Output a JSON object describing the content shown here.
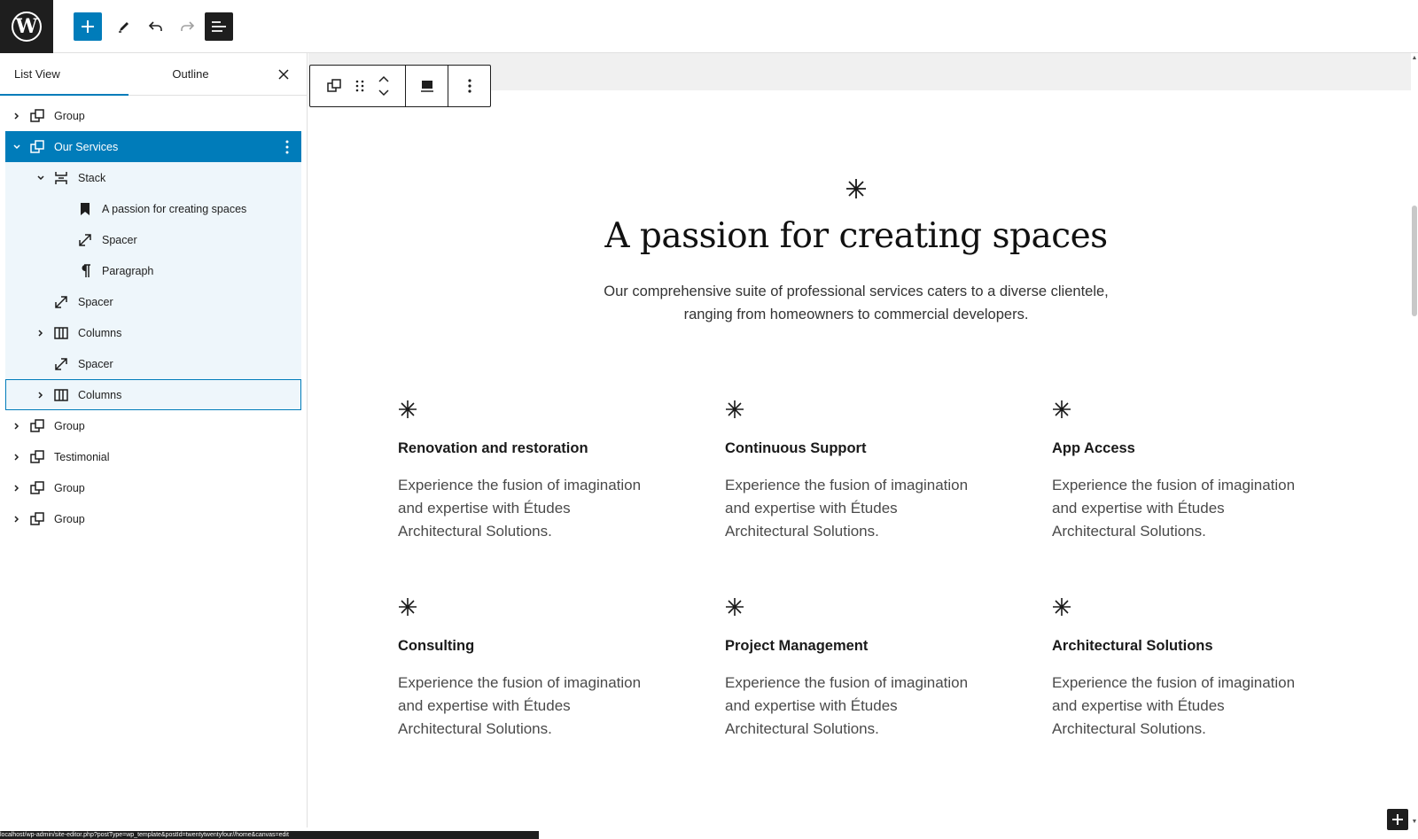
{
  "topbar": {
    "logo": "W",
    "icons": [
      "wordpress-icon",
      "plus-icon",
      "pencil-icon",
      "undo-icon",
      "redo-icon",
      "list-view-icon"
    ]
  },
  "sidebar": {
    "tabs": [
      {
        "label": "List View",
        "active": true
      },
      {
        "label": "Outline",
        "active": false
      }
    ],
    "rows": [
      {
        "label": "Group",
        "icon": "group-icon",
        "level": 0,
        "chevron": "right",
        "state": "normal"
      },
      {
        "label": "Our Services",
        "icon": "group-icon",
        "level": 0,
        "chevron": "down",
        "state": "selected"
      },
      {
        "label": "Stack",
        "icon": "stack-icon",
        "level": 1,
        "chevron": "down",
        "state": "tinted"
      },
      {
        "label": "A passion for creating spaces",
        "icon": "bookmark-icon",
        "level": 2,
        "chevron": "",
        "state": "tinted"
      },
      {
        "label": "Spacer",
        "icon": "spacer-icon",
        "level": 2,
        "chevron": "",
        "state": "tinted"
      },
      {
        "label": "Paragraph",
        "icon": "paragraph-icon",
        "level": 2,
        "chevron": "",
        "state": "tinted"
      },
      {
        "label": "Spacer",
        "icon": "spacer-icon",
        "level": 1,
        "chevron": "",
        "state": "tinted"
      },
      {
        "label": "Columns",
        "icon": "columns-icon",
        "level": 1,
        "chevron": "right",
        "state": "tinted"
      },
      {
        "label": "Spacer",
        "icon": "spacer-icon",
        "level": 1,
        "chevron": "",
        "state": "tinted"
      },
      {
        "label": "Columns",
        "icon": "columns-icon",
        "level": 1,
        "chevron": "right",
        "state": "focused"
      },
      {
        "label": "Group",
        "icon": "group-icon",
        "level": 0,
        "chevron": "right",
        "state": "normal"
      },
      {
        "label": "Testimonial",
        "icon": "group-icon",
        "level": 0,
        "chevron": "right",
        "state": "normal"
      },
      {
        "label": "Group",
        "icon": "group-icon",
        "level": 0,
        "chevron": "right",
        "state": "normal"
      },
      {
        "label": "Group",
        "icon": "group-icon",
        "level": 0,
        "chevron": "right",
        "state": "normal"
      }
    ]
  },
  "block_toolbar": {
    "icons": [
      "group-icon",
      "drag-handle-icon",
      "move-up-icon",
      "move-down-icon",
      "align-icon",
      "more-options-icon"
    ]
  },
  "hero": {
    "title": "A passion for creating spaces",
    "subtitle_line1": "Our comprehensive suite of professional services caters to a diverse clientele,",
    "subtitle_line2": "ranging from homeowners to commercial developers."
  },
  "services": [
    {
      "title": "Renovation and restoration",
      "l1": "Experience the fusion of imagination",
      "l2": "and expertise with Études",
      "l3": "Architectural Solutions."
    },
    {
      "title": "Continuous Support",
      "l1": "Experience the fusion of imagination",
      "l2": "and expertise with Études",
      "l3": "Architectural Solutions."
    },
    {
      "title": "App Access",
      "l1": "Experience the fusion of imagination",
      "l2": "and expertise with Études",
      "l3": "Architectural Solutions."
    },
    {
      "title": "Consulting",
      "l1": "Experience the fusion of imagination",
      "l2": "and expertise with Études",
      "l3": "Architectural Solutions."
    },
    {
      "title": "Project Management",
      "l1": "Experience the fusion of imagination",
      "l2": "and expertise with Études",
      "l3": "Architectural Solutions."
    },
    {
      "title": "Architectural Solutions",
      "l1": "Experience the fusion of imagination",
      "l2": "and expertise with Études",
      "l3": "Architectural Solutions."
    }
  ],
  "status_bar": {
    "text": "localhost/wp-admin/site-editor.php?postType=wp_template&postId=twentytwentyfour//home&canvas=edit"
  },
  "colors": {
    "accent": "#007cba",
    "dark": "#1e1e1e",
    "tinted_row": "#eef6fb"
  }
}
